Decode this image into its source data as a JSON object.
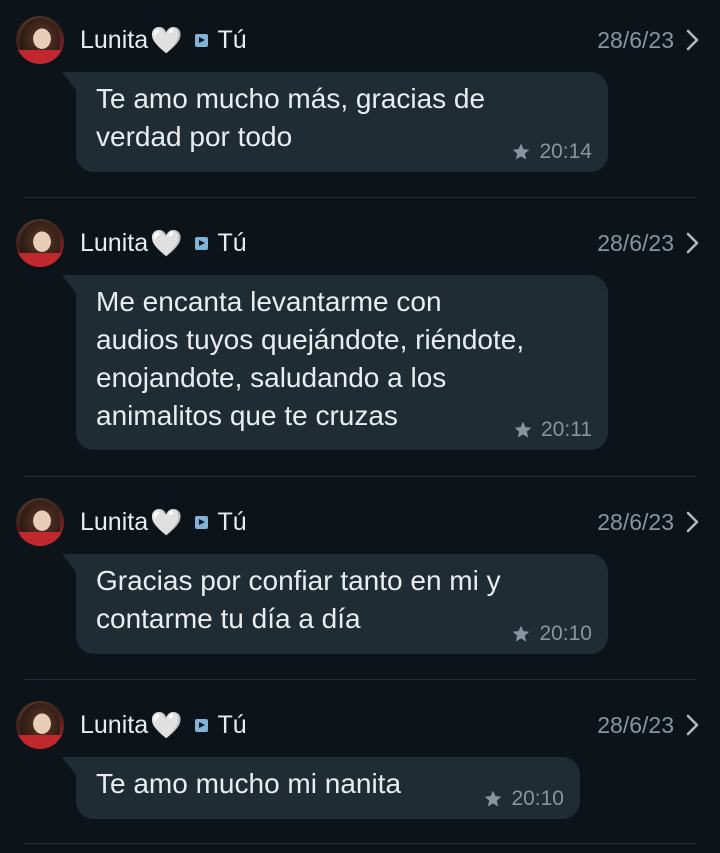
{
  "entries": [
    {
      "sender": "Lunita",
      "recipient": "Tú",
      "date": "28/6/23",
      "message": "Te amo mucho más, gracias de\nverdad por todo",
      "time": "20:14"
    },
    {
      "sender": "Lunita",
      "recipient": "Tú",
      "date": "28/6/23",
      "message": "Me encanta levantarme con\naudios tuyos quejándote, riéndote,\nenojandote, saludando a los\nanimalitos que te cruzas",
      "time": "20:11"
    },
    {
      "sender": "Lunita",
      "recipient": "Tú",
      "date": "28/6/23",
      "message": "Gracias por confiar tanto en mi y\ncontarme tu día a día",
      "time": "20:10"
    },
    {
      "sender": "Lunita",
      "recipient": "Tú",
      "date": "28/6/23",
      "message": "Te amo mucho mi nanita",
      "time": "20:10"
    }
  ],
  "icons": {
    "heart": "white-heart-icon",
    "arrow": "forward-arrow-icon",
    "star": "star-icon",
    "chevron": "chevron-right-icon"
  },
  "colors": {
    "background": "#0c141a",
    "bubble": "#202c33",
    "secondary_text": "#8696a0",
    "arrow_badge": "#7fb3d8"
  }
}
